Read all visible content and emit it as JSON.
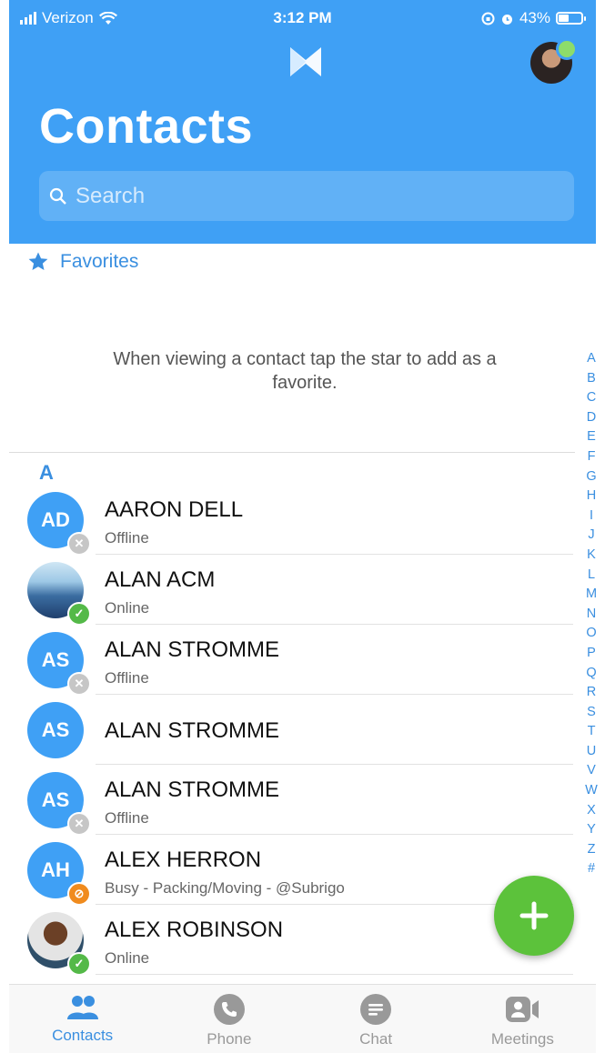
{
  "status_bar": {
    "carrier": "Verizon",
    "time": "3:12 PM",
    "battery": "43%"
  },
  "header": {
    "title": "Contacts",
    "search_placeholder": "Search"
  },
  "favorites": {
    "label": "Favorites",
    "hint": "When viewing a contact tap the star to add as a favorite."
  },
  "section_letter": "A",
  "contacts": [
    {
      "initials": "AD",
      "name": "AARON DELL",
      "status": "Offline",
      "presence": "offline"
    },
    {
      "initials": "",
      "name": "ALAN ACM",
      "status": "Online",
      "presence": "online"
    },
    {
      "initials": "AS",
      "name": "ALAN STROMME",
      "status": "Offline",
      "presence": "offline"
    },
    {
      "initials": "AS",
      "name": "ALAN STROMME",
      "status": "",
      "presence": "none"
    },
    {
      "initials": "AS",
      "name": "ALAN STROMME",
      "status": "Offline",
      "presence": "offline"
    },
    {
      "initials": "AH",
      "name": "ALEX HERRON",
      "status": "Busy - Packing/Moving - @Subrigo",
      "presence": "busy"
    },
    {
      "initials": "",
      "name": "ALEX ROBINSON",
      "status": "Online",
      "presence": "online"
    }
  ],
  "alphabet": [
    "A",
    "B",
    "C",
    "D",
    "E",
    "F",
    "G",
    "H",
    "I",
    "J",
    "K",
    "L",
    "M",
    "N",
    "O",
    "P",
    "Q",
    "R",
    "S",
    "T",
    "U",
    "V",
    "W",
    "X",
    "Y",
    "Z",
    "#"
  ],
  "tabs": [
    {
      "label": "Contacts",
      "icon": "contacts-icon",
      "active": true
    },
    {
      "label": "Phone",
      "icon": "phone-icon",
      "active": false
    },
    {
      "label": "Chat",
      "icon": "chat-icon",
      "active": false
    },
    {
      "label": "Meetings",
      "icon": "meetings-icon",
      "active": false
    }
  ],
  "colors": {
    "brand_blue": "#3fa0f5",
    "accent_blue": "#3a8fe0",
    "online": "#54b948",
    "busy": "#f08b1e",
    "offline": "#c6c6c6",
    "fab": "#5cc23b"
  }
}
